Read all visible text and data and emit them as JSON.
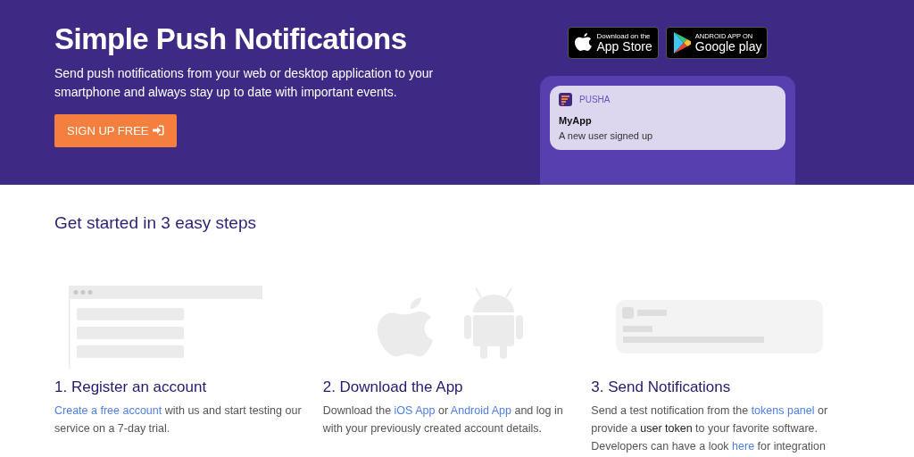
{
  "hero": {
    "title": "Simple Push Notifications",
    "subtitle": "Send push notifications from your web or desktop application to your smartphone and always stay up to date with important events.",
    "signup_button": "SIGN UP FREE",
    "store_badges": [
      {
        "kind": "apple",
        "small": "Download on the",
        "large": "App Store"
      },
      {
        "kind": "google",
        "small": "ANDROID APP ON",
        "large": "Google play"
      }
    ],
    "notification": {
      "app": "PUSHA",
      "title": "MyApp",
      "message": "A new user signed up"
    }
  },
  "steps_heading": "Get started in 3 easy steps",
  "steps": [
    {
      "kind": "browser",
      "title": "1. Register an account",
      "text": [
        {
          "kind": "link",
          "text": "Create a free account"
        },
        {
          "kind": "text",
          "text": " with us and start testing our service on a 7-day trial."
        }
      ]
    },
    {
      "kind": "devices",
      "title": "2. Download the App",
      "text": [
        {
          "kind": "text",
          "text": "Download the "
        },
        {
          "kind": "link",
          "text": "iOS App"
        },
        {
          "kind": "text",
          "text": " or "
        },
        {
          "kind": "link",
          "text": "Android App"
        },
        {
          "kind": "text",
          "text": " and log in with your previously created account details."
        }
      ]
    },
    {
      "kind": "notification",
      "title": "3. Send Notifications",
      "text": [
        {
          "kind": "text",
          "text": "Send a test notification from the "
        },
        {
          "kind": "link",
          "text": "tokens panel"
        },
        {
          "kind": "text",
          "text": " or provide a "
        },
        {
          "kind": "bold",
          "text": "user token"
        },
        {
          "kind": "text",
          "text": " to your favorite software. Developers can have a look "
        },
        {
          "kind": "link",
          "text": "here"
        },
        {
          "kind": "text",
          "text": " for integration"
        }
      ]
    }
  ]
}
